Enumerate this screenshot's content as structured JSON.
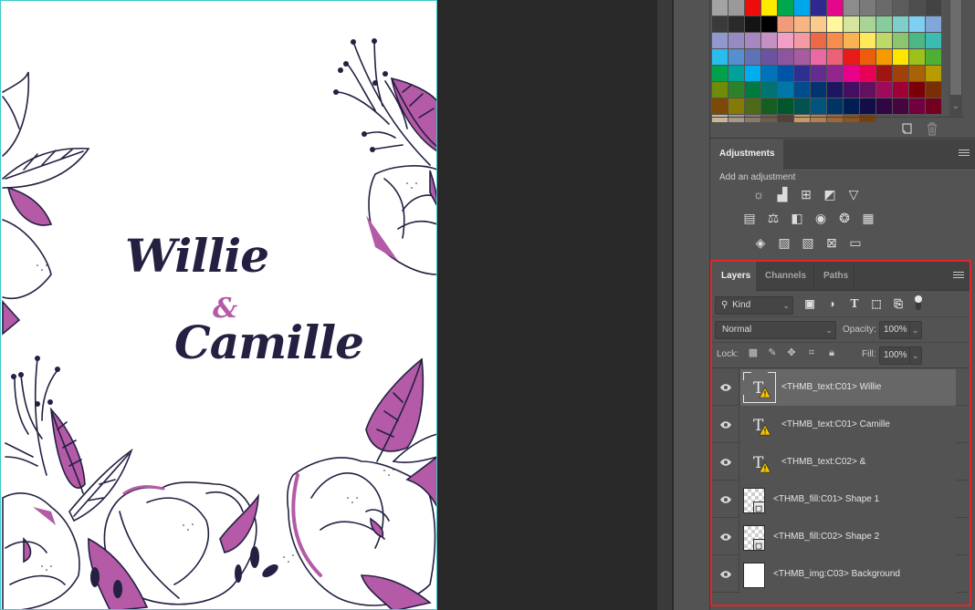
{
  "document": {
    "names": {
      "first": "Willie",
      "ampersand": "&",
      "second": "Camille"
    },
    "colors": {
      "ink": "#232042",
      "accent": "#b45aa6",
      "guide": "#3fc7cc"
    }
  },
  "swatches": {
    "rows": [
      [
        "#a3a3a3",
        "#9a9a9a",
        "#ec0c0c",
        "#fdea00",
        "#00a84d",
        "#00a6ea",
        "#2f2891",
        "#e4078c",
        "#8c8c8c",
        "#7a7a7a",
        "#6a6a6a",
        "#5c5c5c",
        "#4e4e4e",
        "#434343"
      ],
      [
        "#3a3a3a",
        "#2a2a2a",
        "#141414",
        "#000000",
        "#f19b79",
        "#f7b584",
        "#fbcb8e",
        "#fff69d",
        "#d6e59f",
        "#a8d595",
        "#86cc9d",
        "#7ecfc9",
        "#7dd0f3",
        "#83a6da"
      ],
      [
        "#9198ce",
        "#978bc4",
        "#a887c0",
        "#c590c3",
        "#f19fc4",
        "#f49aa3",
        "#ec6947",
        "#f68c4e",
        "#f9b451",
        "#fde95b",
        "#bfd969",
        "#8bc56d",
        "#4cb685",
        "#3bbcb3"
      ],
      [
        "#2abcec",
        "#568fd0",
        "#5f72b5",
        "#6b53a0",
        "#8d559f",
        "#a95ba1",
        "#ea68a4",
        "#ec6078",
        "#e81a1a",
        "#ee5d0c",
        "#f59b00",
        "#fde500",
        "#9cc21a",
        "#4eaf35"
      ],
      [
        "#00a14b",
        "#00a19a",
        "#00adef",
        "#0073bb",
        "#0054a5",
        "#2e3091",
        "#652c90",
        "#92268e",
        "#e9008b",
        "#e80057",
        "#a01414",
        "#a1410a",
        "#a86208",
        "#b79b00"
      ],
      [
        "#6f8b09",
        "#2f8129",
        "#007a3e",
        "#007472",
        "#0077a8",
        "#004c8c",
        "#023472",
        "#1d1761",
        "#440e62",
        "#63105e",
        "#a00a5c",
        "#a10036",
        "#7b0006",
        "#7a2f03"
      ],
      [
        "#7c4a06",
        "#847a05",
        "#4d6a16",
        "#165e1f",
        "#00572b",
        "#005351",
        "#005480",
        "#003467",
        "#001d54",
        "#130e46",
        "#300645",
        "#45053f",
        "#720041",
        "#730021"
      ],
      [
        "#c8b69a",
        "#a89888",
        "#8a7a6c",
        "#6c5c50",
        "#534237",
        "#c59a6a",
        "#b28054",
        "#9c6838",
        "#8a5424",
        "#774012",
        "",
        "",
        "",
        ""
      ]
    ],
    "icons": [
      "new-swatch-icon",
      "delete-swatch-icon"
    ]
  },
  "adjustments": {
    "tab_label": "Adjustments",
    "add_label": "Add an adjustment",
    "rows": [
      [
        {
          "name": "brightness-contrast-icon",
          "glyph": "☼"
        },
        {
          "name": "levels-icon",
          "glyph": "▟"
        },
        {
          "name": "curves-icon",
          "glyph": "⊞"
        },
        {
          "name": "exposure-icon",
          "glyph": "◩"
        },
        {
          "name": "vibrance-icon",
          "glyph": "▽"
        }
      ],
      [
        {
          "name": "hue-saturation-icon",
          "glyph": "▤"
        },
        {
          "name": "color-balance-icon",
          "glyph": "⚖"
        },
        {
          "name": "black-white-icon",
          "glyph": "◧"
        },
        {
          "name": "photo-filter-icon",
          "glyph": "◉"
        },
        {
          "name": "channel-mixer-icon",
          "glyph": "❂"
        },
        {
          "name": "color-lookup-icon",
          "glyph": "▦"
        }
      ],
      [
        {
          "name": "invert-icon",
          "glyph": "◈"
        },
        {
          "name": "posterize-icon",
          "glyph": "▨"
        },
        {
          "name": "threshold-icon",
          "glyph": "▧"
        },
        {
          "name": "selective-color-icon",
          "glyph": "⊠"
        },
        {
          "name": "gradient-map-icon",
          "glyph": "▭"
        }
      ]
    ]
  },
  "layers_panel": {
    "tabs": [
      {
        "label": "Layers",
        "active": true
      },
      {
        "label": "Channels",
        "active": false
      },
      {
        "label": "Paths",
        "active": false
      }
    ],
    "filter": {
      "label": "Kind"
    },
    "blend_mode": "Normal",
    "opacity_label": "Opacity:",
    "opacity_value": "100%",
    "lock_label": "Lock:",
    "fill_label": "Fill:",
    "fill_value": "100%",
    "layers": [
      {
        "name": "<THMB_text:C01> Willie",
        "type": "text",
        "visible": true,
        "selected": true
      },
      {
        "name": "<THMB_text:C01> Camille",
        "type": "text",
        "visible": true,
        "selected": false
      },
      {
        "name": "<THMB_text:C02> &",
        "type": "text",
        "visible": true,
        "selected": false
      },
      {
        "name": "<THMB_fill:C01> Shape 1",
        "type": "shape",
        "visible": true,
        "selected": false
      },
      {
        "name": "<THMB_fill:C02> Shape 2",
        "type": "shape",
        "visible": true,
        "selected": false
      },
      {
        "name": "<THMB_img:C03> Background",
        "type": "image",
        "visible": true,
        "selected": false
      }
    ]
  },
  "highlight_color": "#e02626"
}
